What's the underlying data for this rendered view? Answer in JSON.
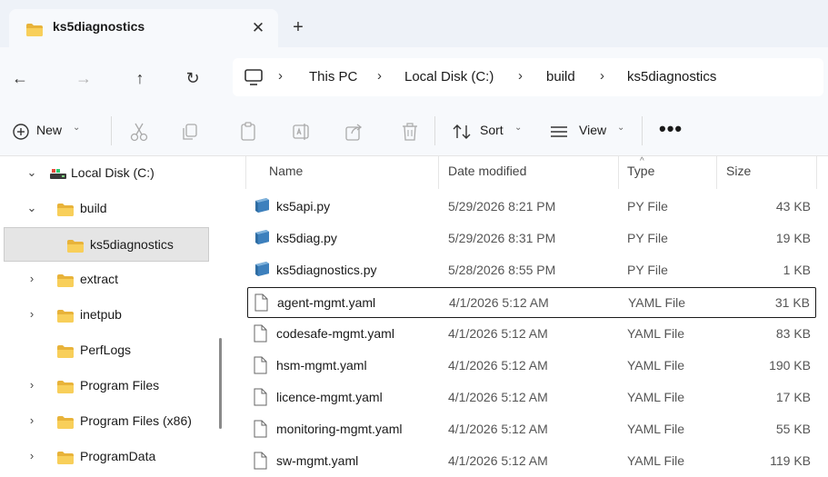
{
  "tab": {
    "title": "ks5diagnostics",
    "close_glyph": "✕",
    "new_glyph": "+"
  },
  "nav": {
    "back_glyph": "←",
    "forward_glyph": "→",
    "up_glyph": "↑",
    "refresh_glyph": "↻"
  },
  "breadcrumb": {
    "separator": "›",
    "items": [
      "This PC",
      "Local Disk (C:)",
      "build",
      "ks5diagnostics"
    ]
  },
  "toolbar": {
    "new_label": "New",
    "sort_label": "Sort",
    "view_label": "View",
    "more_glyph": "•••",
    "caret_glyph": "⌄"
  },
  "sidebar": {
    "items": [
      {
        "label": "Local Disk (C:)",
        "chevron": "⌄"
      },
      {
        "label": "build",
        "chevron": "⌄"
      },
      {
        "label": "ks5diagnostics",
        "chevron": "",
        "selected": true
      },
      {
        "label": "extract",
        "chevron": "›"
      },
      {
        "label": "inetpub",
        "chevron": "›"
      },
      {
        "label": "PerfLogs",
        "chevron": ""
      },
      {
        "label": "Program Files",
        "chevron": "›"
      },
      {
        "label": "Program Files (x86)",
        "chevron": "›"
      },
      {
        "label": "ProgramData",
        "chevron": "›"
      }
    ]
  },
  "columns": {
    "name": "Name",
    "date": "Date modified",
    "type": "Type",
    "size": "Size",
    "sort_glyph": "^"
  },
  "files": [
    {
      "name": "ks5api.py",
      "date": "5/29/2026 8:21 PM",
      "type": "PY File",
      "size": "43 KB",
      "icon": "python-file-icon"
    },
    {
      "name": "ks5diag.py",
      "date": "5/29/2026 8:31 PM",
      "type": "PY File",
      "size": "19 KB",
      "icon": "python-file-icon"
    },
    {
      "name": "ks5diagnostics.py",
      "date": "5/28/2026 8:55 PM",
      "type": "PY File",
      "size": "1 KB",
      "icon": "python-file-icon"
    },
    {
      "name": "agent-mgmt.yaml",
      "date": "4/1/2026 5:12 AM",
      "type": "YAML File",
      "size": "31 KB",
      "icon": "document-icon",
      "focused": true
    },
    {
      "name": "codesafe-mgmt.yaml",
      "date": "4/1/2026 5:12 AM",
      "type": "YAML File",
      "size": "83 KB",
      "icon": "document-icon"
    },
    {
      "name": "hsm-mgmt.yaml",
      "date": "4/1/2026 5:12 AM",
      "type": "YAML File",
      "size": "190 KB",
      "icon": "document-icon"
    },
    {
      "name": "licence-mgmt.yaml",
      "date": "4/1/2026 5:12 AM",
      "type": "YAML File",
      "size": "17 KB",
      "icon": "document-icon"
    },
    {
      "name": "monitoring-mgmt.yaml",
      "date": "4/1/2026 5:12 AM",
      "type": "YAML File",
      "size": "55 KB",
      "icon": "document-icon"
    },
    {
      "name": "sw-mgmt.yaml",
      "date": "4/1/2026 5:12 AM",
      "type": "YAML File",
      "size": "119 KB",
      "icon": "document-icon"
    }
  ],
  "colors": {
    "folder": "#f6c343",
    "folder_dark": "#e0a526",
    "python": "#4a7fb0",
    "accent": "#0067c0"
  }
}
